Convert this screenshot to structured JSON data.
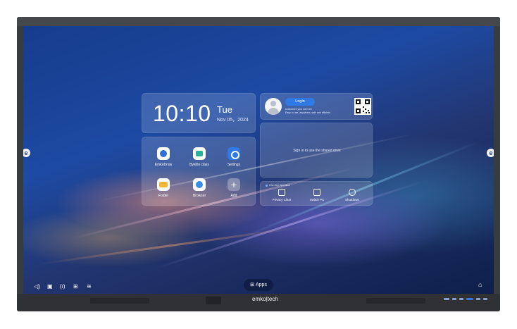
{
  "clock": {
    "time": "10:10",
    "day": "Tue",
    "date": "Nov 05，2024"
  },
  "apps": [
    {
      "label": "EmkoDraw",
      "icon": "draw-app-icon"
    },
    {
      "label": "Bytello class",
      "icon": "class-app-icon"
    },
    {
      "label": "Settings",
      "icon": "settings-icon"
    },
    {
      "label": "Folder",
      "icon": "folder-icon"
    },
    {
      "label": "Browser",
      "icon": "browser-icon"
    },
    {
      "label": "Add",
      "icon": "add-icon"
    }
  ],
  "login": {
    "button_label": "Login",
    "subtitle_line1": "Customize your own OS",
    "subtitle_line2": "Easy to use, anywhere, safe and efficient"
  },
  "shared": {
    "message": "Sign in to use the shared drive"
  },
  "one_key": {
    "title": "One-Key Operation",
    "items": [
      {
        "label": "Privacy Clear",
        "icon": "privacy-clear-icon"
      },
      {
        "label": "Switch PC",
        "icon": "switch-pc-icon"
      },
      {
        "label": "Shutdown",
        "icon": "shutdown-icon"
      }
    ]
  },
  "taskbar": {
    "apps_label": "Apps",
    "status_icons": [
      "volume-icon",
      "usb-icon",
      "signal-icon",
      "network-icon",
      "wifi-icon"
    ]
  },
  "side_button_label": "e",
  "bezel": {
    "brand": "emko|tech"
  },
  "colors": {
    "accent": "#2f7ae5",
    "bezel": "#3a3b3e",
    "panel": "rgba(255,255,255,0.16)"
  }
}
